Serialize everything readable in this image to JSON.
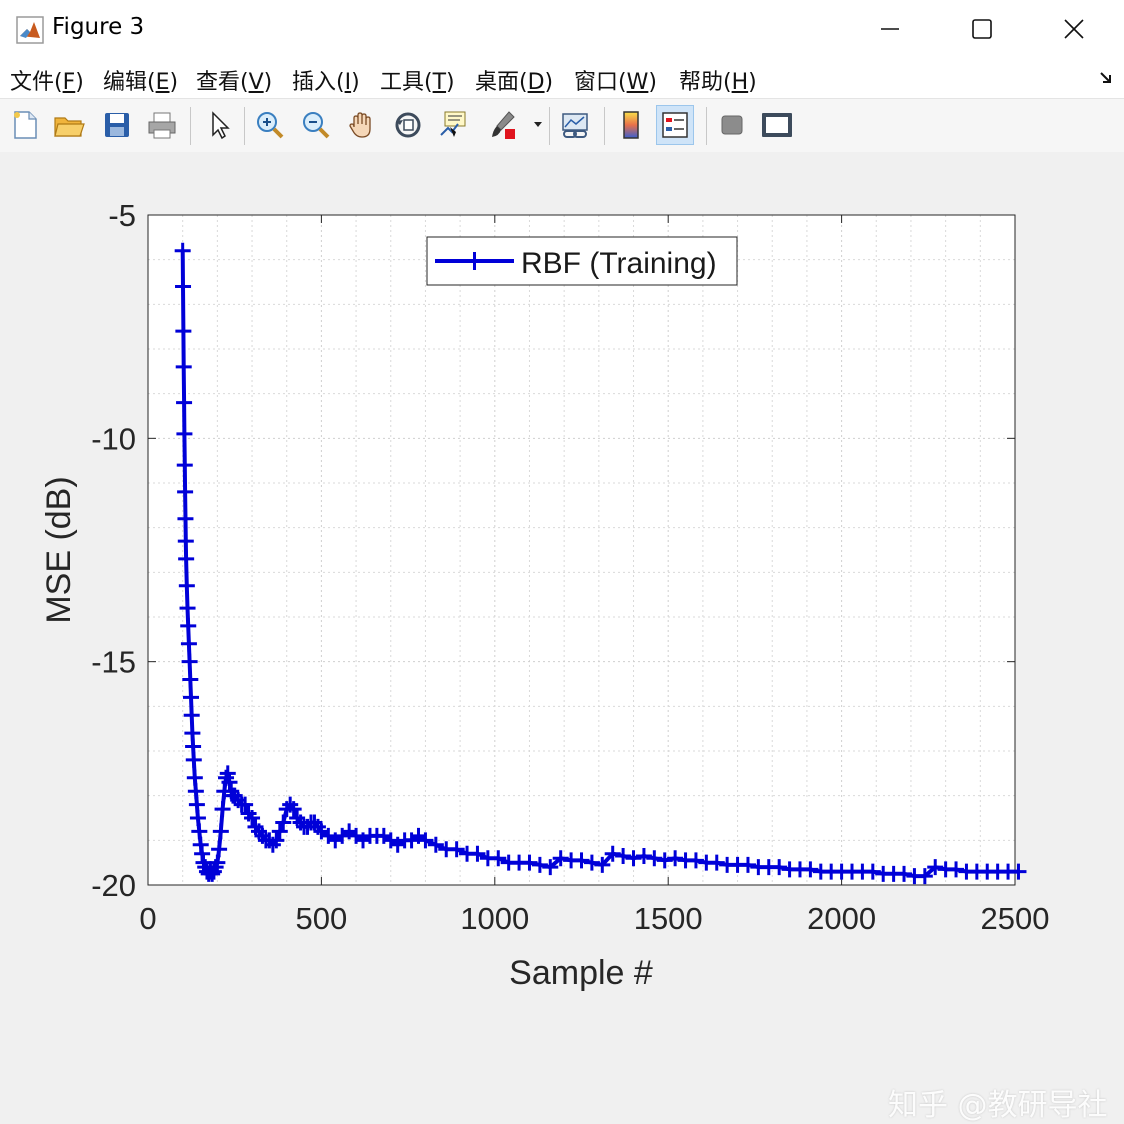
{
  "window": {
    "title": "Figure 3",
    "minimize_glyph": "—",
    "maximize_glyph": "☐",
    "close_glyph": "✕"
  },
  "menu": [
    {
      "label": "文件(",
      "key": "F",
      "tail": ")"
    },
    {
      "label": "编辑(",
      "key": "E",
      "tail": ")"
    },
    {
      "label": "查看(",
      "key": "V",
      "tail": ")"
    },
    {
      "label": "插入(",
      "key": "I",
      "tail": ")"
    },
    {
      "label": "工具(",
      "key": "T",
      "tail": ")"
    },
    {
      "label": "桌面(",
      "key": "D",
      "tail": ")"
    },
    {
      "label": "窗口(",
      "key": "W",
      "tail": ")"
    },
    {
      "label": "帮助(",
      "key": "H",
      "tail": ")"
    }
  ],
  "toolbar_icons": [
    "new-figure-icon",
    "open-file-icon",
    "save-icon",
    "print-icon",
    "pointer-icon",
    "zoom-in-icon",
    "zoom-out-icon",
    "pan-icon",
    "rotate-3d-icon",
    "data-cursor-icon",
    "brush-icon",
    "link-plot-icon",
    "colorbar-icon",
    "legend-icon",
    "hide-plot-tools-icon",
    "show-plot-tools-icon"
  ],
  "watermark": "知乎 @教研导社",
  "colors": {
    "line": "#0000d8",
    "grid": "#d9d9d9",
    "axes_bg": "#ffffff"
  },
  "chart_data": {
    "type": "line",
    "title": "",
    "xlabel": "Sample #",
    "ylabel": "MSE (dB)",
    "xlim": [
      0,
      2500
    ],
    "ylim": [
      -20,
      -5
    ],
    "xticks": [
      0,
      500,
      1000,
      1500,
      2000,
      2500
    ],
    "yticks": [
      -5,
      -10,
      -15,
      -20
    ],
    "grid": "minor",
    "legend": "top-center",
    "series": [
      {
        "name": "RBF (Training)",
        "marker": "+",
        "x": [
          100,
          101,
          102,
          103,
          104,
          105,
          106,
          107,
          108,
          109,
          110,
          112,
          114,
          116,
          118,
          120,
          122,
          124,
          126,
          128,
          130,
          132,
          135,
          138,
          141,
          144,
          148,
          152,
          156,
          160,
          165,
          170,
          175,
          180,
          185,
          190,
          195,
          200,
          205,
          210,
          215,
          220,
          225,
          230,
          235,
          240,
          245,
          250,
          260,
          270,
          280,
          290,
          300,
          310,
          320,
          330,
          340,
          350,
          360,
          370,
          380,
          390,
          400,
          410,
          420,
          430,
          440,
          450,
          460,
          470,
          480,
          490,
          500,
          520,
          540,
          560,
          580,
          600,
          620,
          640,
          660,
          680,
          700,
          720,
          740,
          760,
          780,
          800,
          830,
          860,
          890,
          920,
          950,
          980,
          1010,
          1040,
          1070,
          1100,
          1130,
          1160,
          1190,
          1220,
          1250,
          1280,
          1310,
          1340,
          1370,
          1400,
          1430,
          1460,
          1490,
          1520,
          1550,
          1580,
          1610,
          1640,
          1670,
          1700,
          1730,
          1760,
          1790,
          1820,
          1850,
          1880,
          1910,
          1940,
          1970,
          2000,
          2030,
          2060,
          2090,
          2120,
          2150,
          2180,
          2210,
          2240,
          2270,
          2300,
          2330,
          2360,
          2390,
          2420,
          2450,
          2480,
          2510
        ],
        "y": [
          -5.8,
          -6.6,
          -7.6,
          -8.4,
          -9.2,
          -9.9,
          -10.6,
          -11.2,
          -11.8,
          -12.3,
          -12.7,
          -13.3,
          -13.8,
          -14.2,
          -14.6,
          -15.0,
          -15.4,
          -15.8,
          -16.2,
          -16.6,
          -16.9,
          -17.2,
          -17.6,
          -17.9,
          -18.2,
          -18.5,
          -18.8,
          -19.1,
          -19.3,
          -19.5,
          -19.6,
          -19.7,
          -19.75,
          -19.7,
          -19.75,
          -19.7,
          -19.6,
          -19.5,
          -19.2,
          -18.8,
          -18.3,
          -17.9,
          -17.6,
          -17.5,
          -17.7,
          -17.9,
          -18.0,
          -18.0,
          -18.1,
          -18.2,
          -18.2,
          -18.4,
          -18.5,
          -18.7,
          -18.8,
          -18.9,
          -19.0,
          -19.0,
          -19.1,
          -19.0,
          -18.8,
          -18.6,
          -18.3,
          -18.2,
          -18.3,
          -18.5,
          -18.6,
          -18.7,
          -18.7,
          -18.6,
          -18.6,
          -18.7,
          -18.8,
          -18.9,
          -19.0,
          -18.9,
          -18.8,
          -18.9,
          -19.0,
          -18.9,
          -18.9,
          -18.9,
          -19.0,
          -19.1,
          -19.0,
          -19.0,
          -18.9,
          -19.0,
          -19.1,
          -19.2,
          -19.2,
          -19.3,
          -19.3,
          -19.4,
          -19.4,
          -19.5,
          -19.5,
          -19.5,
          -19.55,
          -19.6,
          -19.4,
          -19.45,
          -19.45,
          -19.5,
          -19.55,
          -19.3,
          -19.35,
          -19.4,
          -19.35,
          -19.4,
          -19.45,
          -19.4,
          -19.45,
          -19.45,
          -19.5,
          -19.5,
          -19.55,
          -19.55,
          -19.55,
          -19.6,
          -19.6,
          -19.6,
          -19.65,
          -19.65,
          -19.65,
          -19.7,
          -19.7,
          -19.7,
          -19.7,
          -19.7,
          -19.7,
          -19.75,
          -19.75,
          -19.75,
          -19.8,
          -19.8,
          -19.6,
          -19.65,
          -19.65,
          -19.7,
          -19.7,
          -19.7,
          -19.7,
          -19.7,
          -19.7
        ]
      }
    ]
  }
}
